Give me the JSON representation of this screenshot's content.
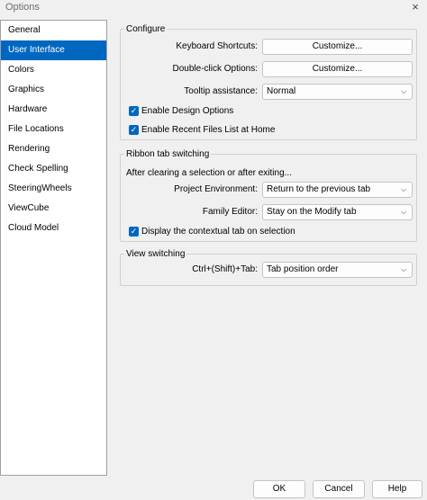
{
  "window": {
    "title": "Options",
    "close_glyph": "×"
  },
  "sidebar": {
    "items": [
      {
        "label": "General"
      },
      {
        "label": "User Interface",
        "selected": true
      },
      {
        "label": "Colors"
      },
      {
        "label": "Graphics"
      },
      {
        "label": "Hardware"
      },
      {
        "label": "File Locations"
      },
      {
        "label": "Rendering"
      },
      {
        "label": "Check Spelling"
      },
      {
        "label": "SteeringWheels"
      },
      {
        "label": "ViewCube"
      },
      {
        "label": "Cloud Model"
      }
    ]
  },
  "configure": {
    "title": "Configure",
    "keyboard_shortcuts_label": "Keyboard Shortcuts:",
    "keyboard_shortcuts_button": "Customize...",
    "double_click_label": "Double-click Options:",
    "double_click_button": "Customize...",
    "tooltip_label": "Tooltip assistance:",
    "tooltip_value": "Normal",
    "enable_design_options": {
      "label": "Enable Design Options",
      "checked": true
    },
    "enable_recent_files": {
      "label": "Enable Recent Files List at Home",
      "checked": true
    }
  },
  "ribbon": {
    "title": "Ribbon tab switching",
    "after_clearing_text": "After clearing a selection or after exiting...",
    "project_env_label": "Project Environment:",
    "project_env_value": "Return to the previous tab",
    "family_editor_label": "Family Editor:",
    "family_editor_value": "Stay on the Modify tab",
    "contextual_tab": {
      "label": "Display the contextual tab on selection",
      "checked": true
    }
  },
  "view_switching": {
    "title": "View switching",
    "ctrl_tab_label": "Ctrl+(Shift)+Tab:",
    "ctrl_tab_value": "Tab position order"
  },
  "footer": {
    "ok": "OK",
    "cancel": "Cancel",
    "help": "Help"
  },
  "colors": {
    "accent": "#0067c0",
    "background": "#f0f0f0"
  }
}
